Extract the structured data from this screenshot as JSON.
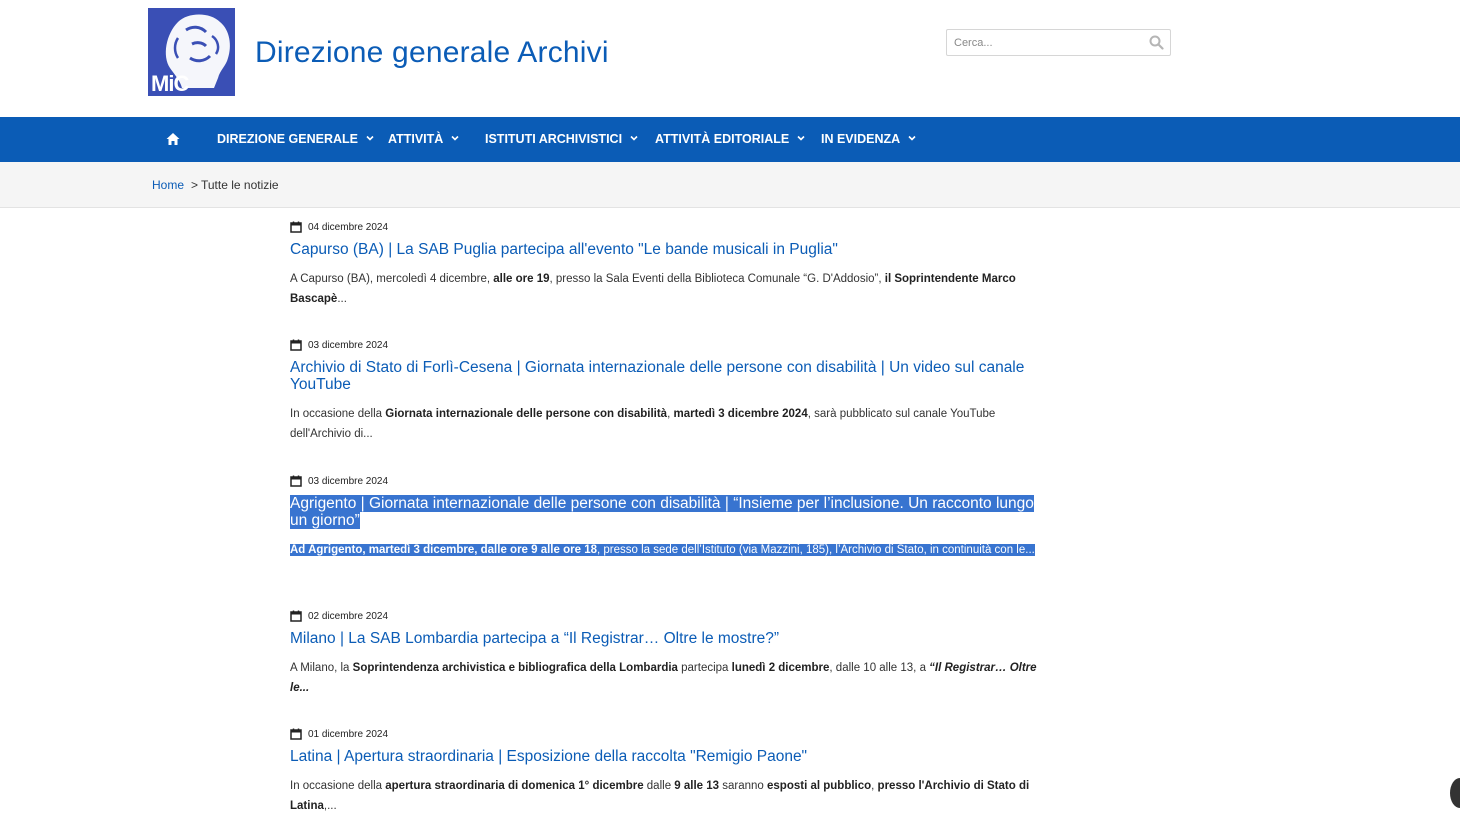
{
  "header": {
    "logo_text": "MiC",
    "site_title": "Direzione generale Archivi",
    "search_placeholder": "Cerca..."
  },
  "nav": {
    "items": [
      {
        "label": "DIREZIONE GENERALE"
      },
      {
        "label": "ATTIVITÀ"
      },
      {
        "label": "ISTITUTI ARCHIVISTICI"
      },
      {
        "label": "ATTIVITÀ EDITORIALE"
      },
      {
        "label": "IN EVIDENZA"
      }
    ]
  },
  "breadcrumb": {
    "home": "Home",
    "separator": ">",
    "current": "Tutte le notizie"
  },
  "news": [
    {
      "date": "04 dicembre 2024",
      "title": "Capurso (BA) | La SAB Puglia partecipa all'evento \"Le bande musicali in Puglia\"",
      "excerpt_parts": [
        "A Capurso (BA), mercoledì 4 dicembre, ",
        "alle ore 19",
        ", presso la Sala Eventi della Biblioteca Comunale “G. D'Addosio”, ",
        "il Soprintendente Marco Bascapè",
        "..."
      ]
    },
    {
      "date": "03 dicembre 2024",
      "title": "Archivio di Stato di Forlì-Cesena | Giornata internazionale delle persone con disabilità | Un video sul canale YouTube",
      "excerpt_parts": [
        "In occasione della ",
        "Giornata internazionale delle persone con disabilità",
        ", ",
        "martedì 3 dicembre 2024",
        ", sarà pubblicato sul canale YouTube dell'Archivio di..."
      ]
    },
    {
      "date": "03 dicembre 2024",
      "title": "Agrigento | Giornata internazionale delle persone con disabilità | “Insieme per l’inclusione. Un racconto lungo un giorno”",
      "excerpt_parts": [
        "Ad Agrigento, martedì 3 dicembre, dalle ore 9 alle ore 18",
        ", presso la sede dell’Istituto (via Mazzini, 185), l’Archivio di Stato, in continuità con le..."
      ]
    },
    {
      "date": "02 dicembre 2024",
      "title": "Milano | La SAB Lombardia partecipa a “Il Registrar… Oltre le mostre?”",
      "excerpt_parts": [
        "A Milano, la ",
        "Soprintendenza archivistica e bibliografica della Lombardia",
        " partecipa ",
        "lunedì 2 dicembre",
        ", dalle 10 alle 13, a ",
        "“Il Registrar… Oltre le..."
      ]
    },
    {
      "date": "01 dicembre 2024",
      "title": "Latina | Apertura straordinaria | Esposizione della raccolta \"Remigio Paone\"",
      "excerpt_parts": [
        "In occasione della ",
        "apertura straordinaria di domenica 1° dicembre",
        " dalle ",
        "9 alle 13",
        " saranno ",
        "esposti al pubblico",
        ", ",
        "presso l'Archivio di Stato di Latina",
        ",..."
      ]
    }
  ],
  "colors": {
    "brand_blue": "#0b5cb6",
    "logo_blue": "#3a4fb5",
    "selection": "#3874d0"
  }
}
